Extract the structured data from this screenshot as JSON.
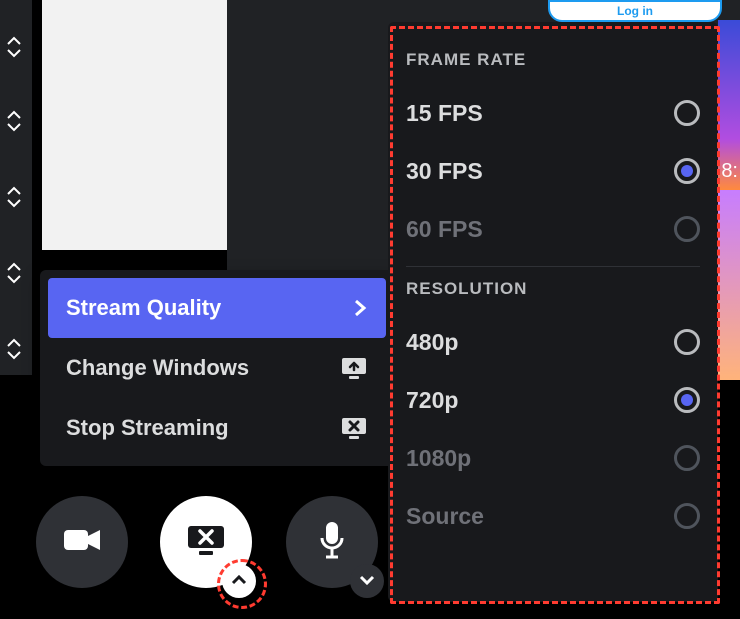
{
  "login_label": "Log in",
  "phone_time": "8:",
  "menu": {
    "items": [
      {
        "label": "Stream Quality"
      },
      {
        "label": "Change Windows"
      },
      {
        "label": "Stop Streaming"
      }
    ]
  },
  "quality": {
    "frame_rate_title": "Frame Rate",
    "resolution_title": "Resolution",
    "frame_rates": [
      {
        "label": "15 FPS",
        "selected": false,
        "disabled": false
      },
      {
        "label": "30 FPS",
        "selected": true,
        "disabled": false
      },
      {
        "label": "60 FPS",
        "selected": false,
        "disabled": true
      }
    ],
    "resolutions": [
      {
        "label": "480p",
        "selected": false,
        "disabled": false
      },
      {
        "label": "720p",
        "selected": true,
        "disabled": false
      },
      {
        "label": "1080p",
        "selected": false,
        "disabled": true
      },
      {
        "label": "Source",
        "selected": false,
        "disabled": true
      }
    ]
  }
}
